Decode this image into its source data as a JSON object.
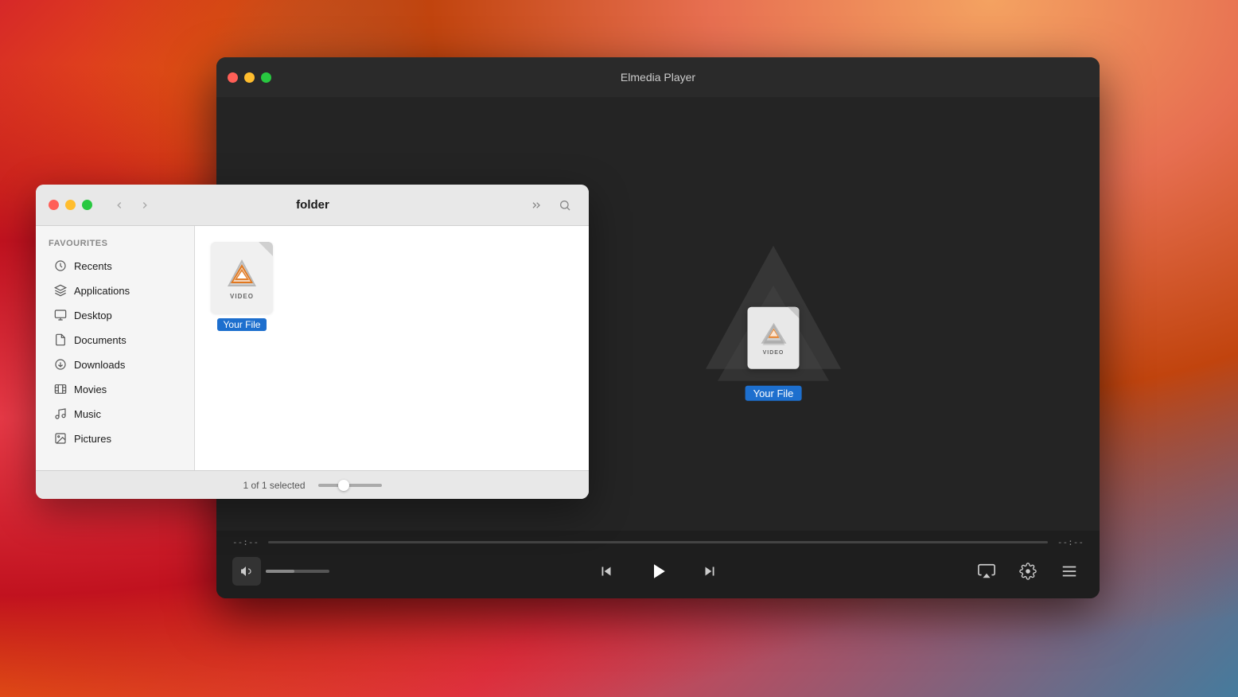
{
  "desktop": {
    "background": "macOS Big Sur gradient"
  },
  "player": {
    "title": "Elmedia Player",
    "traffic_lights": {
      "close": "close",
      "minimize": "minimize",
      "maximize": "maximize"
    },
    "file_label": "Your File",
    "time_start": "--:--",
    "time_end": "--:--",
    "controls": {
      "prev_label": "⏮",
      "play_label": "▶",
      "next_label": "⏭",
      "volume_icon": "🔈",
      "airplay_icon": "airplay",
      "settings_icon": "⚙",
      "playlist_icon": "≡"
    }
  },
  "finder": {
    "title": "folder",
    "sidebar": {
      "section_label": "Favourites",
      "items": [
        {
          "label": "Recents",
          "icon": "🕐"
        },
        {
          "label": "Applications",
          "icon": "🚀"
        },
        {
          "label": "Desktop",
          "icon": "🖥"
        },
        {
          "label": "Documents",
          "icon": "📄"
        },
        {
          "label": "Downloads",
          "icon": "⬇"
        },
        {
          "label": "Movies",
          "icon": "🎬"
        },
        {
          "label": "Music",
          "icon": "🎵"
        },
        {
          "label": "Pictures",
          "icon": "📷"
        }
      ]
    },
    "file": {
      "name": "Your File",
      "tag": "VIDEO"
    },
    "statusbar": {
      "selection_text": "1 of 1 selected"
    }
  }
}
